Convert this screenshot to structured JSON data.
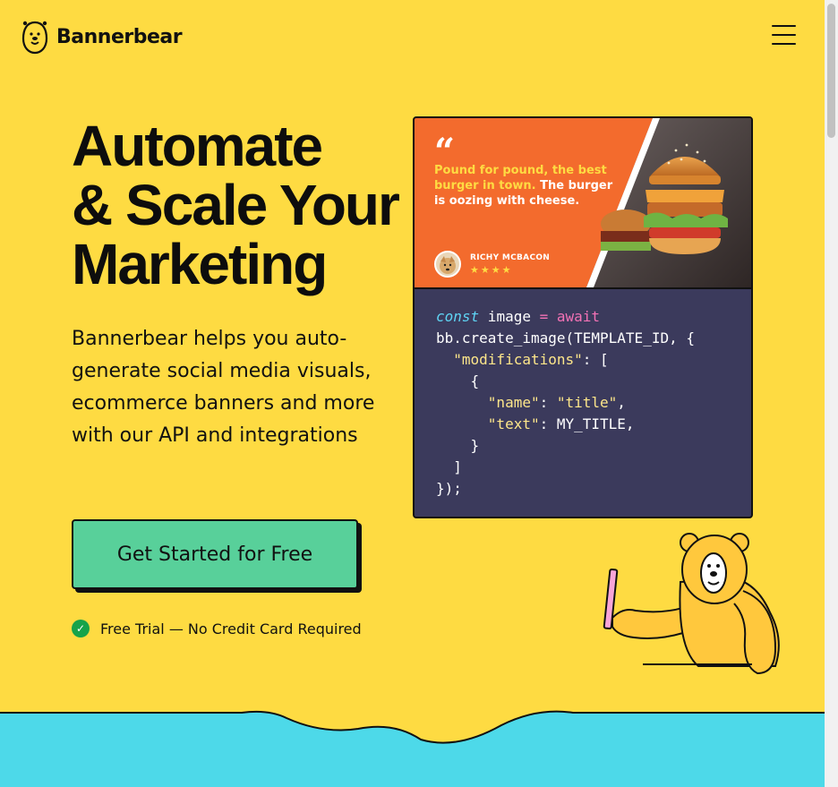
{
  "brand": {
    "name": "Bannerbear"
  },
  "nav": {
    "menu_icon": "hamburger-menu-icon"
  },
  "hero": {
    "title_lines": [
      "Automate",
      "& Scale Your",
      "Marketing"
    ],
    "description": "Bannerbear helps you auto-generate social media visuals, ecommerce banners and more with our API and integrations",
    "cta_label": "Get Started for Free",
    "trial_note": "Free Trial — No Credit Card Required"
  },
  "preview": {
    "quote_mark": "“",
    "quote_highlight": "Pound for pound, the best burger in town.",
    "quote_rest": " The burger is oozing with cheese.",
    "author_name": "RICHY MCBACON",
    "rating_stars": "★★★★",
    "rating": 4
  },
  "code_sample": {
    "kw_const": "const",
    "var_image": " image ",
    "op_eq": "=",
    "kw_await": " await",
    "line2": "bb.create_image(TEMPLATE_ID, {",
    "key_mods": "\"modifications\"",
    "after_mods": ": [",
    "brace_open": "{",
    "key_name": "\"name\"",
    "val_title": "\"title\"",
    "key_text": "\"text\"",
    "val_text": "MY_TITLE",
    "brace_close": "}",
    "bracket_close": "]",
    "end": "});"
  },
  "colors": {
    "background": "#fedb42",
    "cta": "#58d09a",
    "wave": "#4dd9e9",
    "code_bg": "#3b3a5c",
    "banner": "#f36b2d"
  }
}
